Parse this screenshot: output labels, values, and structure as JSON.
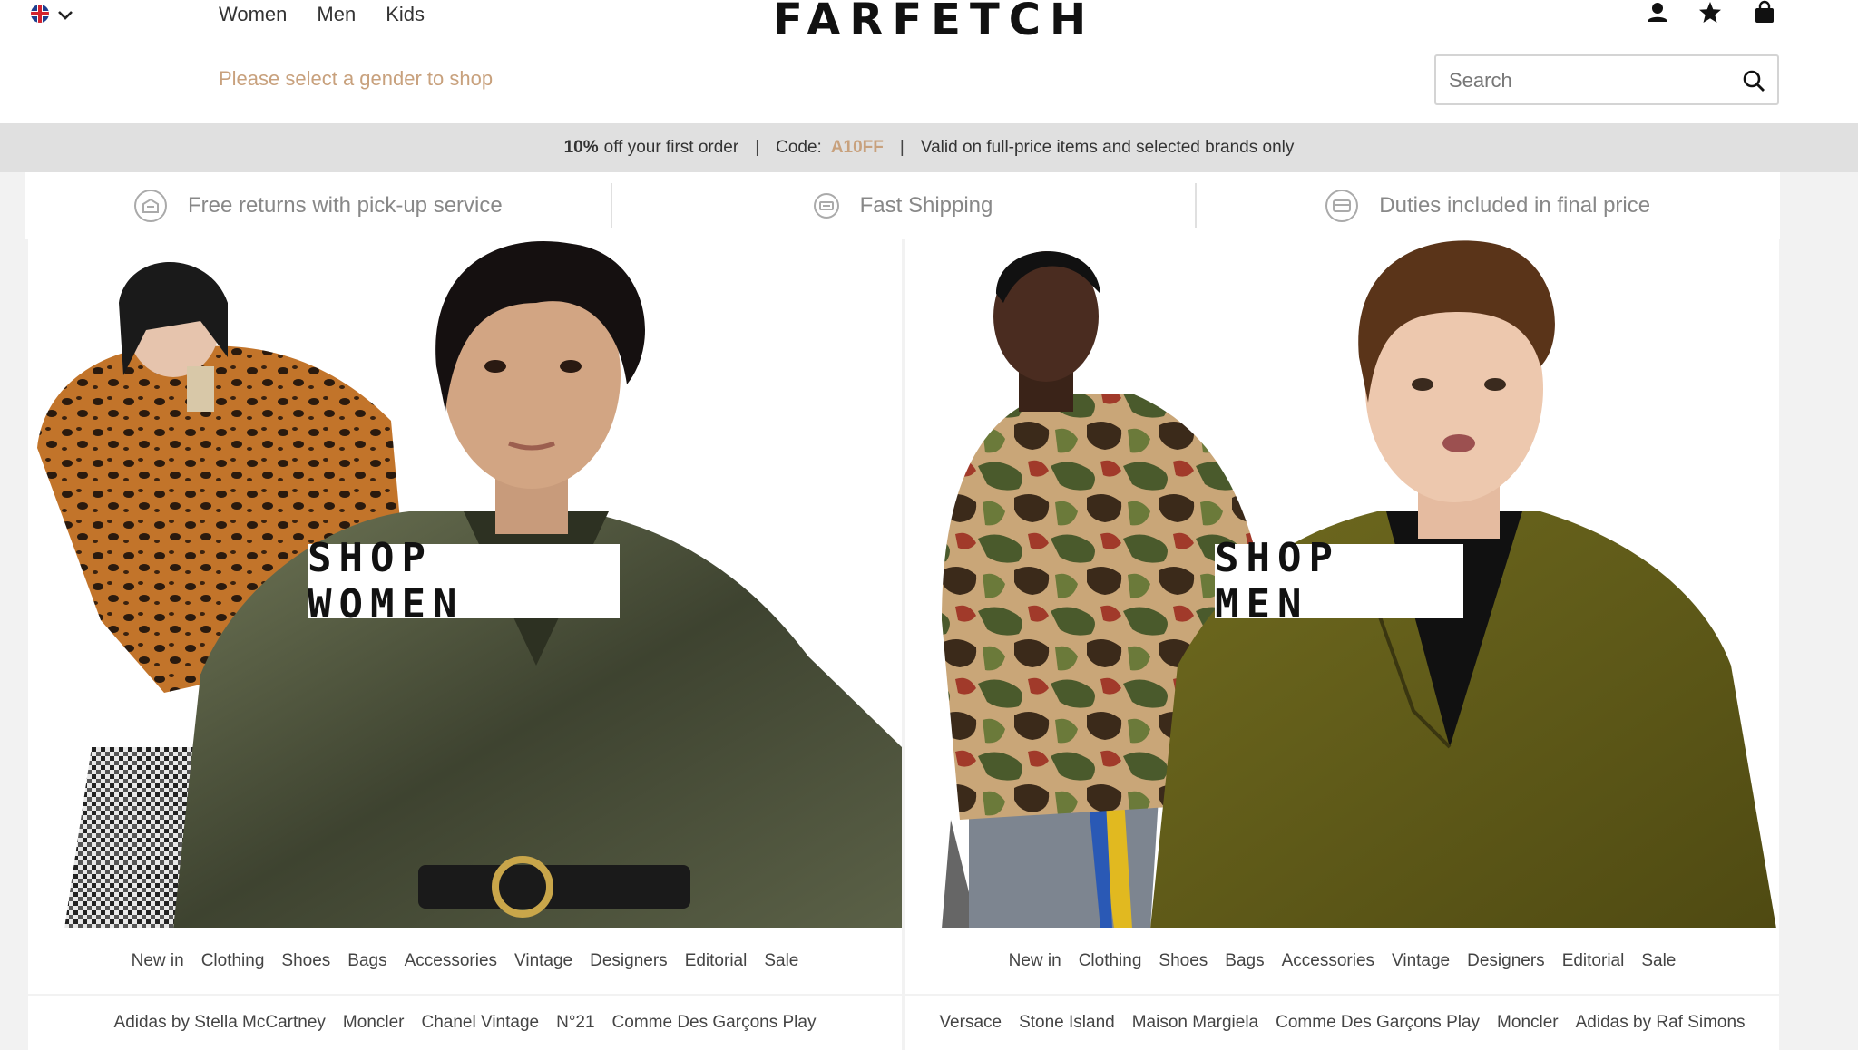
{
  "header": {
    "gender_nav": [
      "Women",
      "Men",
      "Kids"
    ],
    "gender_hint": "Please select a gender to shop",
    "logo": "FARFETCH",
    "search_placeholder": "Search"
  },
  "promo": {
    "percent": "10%",
    "text1": "off your first order",
    "code_label": "Code:",
    "code": "A10FF",
    "text2": "Valid on full-price items and selected brands only"
  },
  "benefits": [
    {
      "label": "Free returns with pick-up service",
      "icon": "returns-icon"
    },
    {
      "label": "Fast Shipping",
      "icon": "shipping-icon"
    },
    {
      "label": "Duties included in final price",
      "icon": "duties-icon"
    }
  ],
  "women": {
    "shop_label": "SHOP WOMEN",
    "categories": [
      "New in",
      "Clothing",
      "Shoes",
      "Bags",
      "Accessories",
      "Vintage",
      "Designers",
      "Editorial",
      "Sale"
    ],
    "designers": [
      "Adidas by Stella McCartney",
      "Moncler",
      "Chanel Vintage",
      "N°21",
      "Comme Des Garçons Play"
    ]
  },
  "men": {
    "shop_label": "SHOP MEN",
    "categories": [
      "New in",
      "Clothing",
      "Shoes",
      "Bags",
      "Accessories",
      "Vintage",
      "Designers",
      "Editorial",
      "Sale"
    ],
    "designers": [
      "Versace",
      "Stone Island",
      "Maison Margiela",
      "Comme Des Garçons Play",
      "Moncler",
      "Adidas by Raf Simons"
    ]
  },
  "colors": {
    "accent": "#c8a17d",
    "promo_bg": "#e0e0e0"
  }
}
